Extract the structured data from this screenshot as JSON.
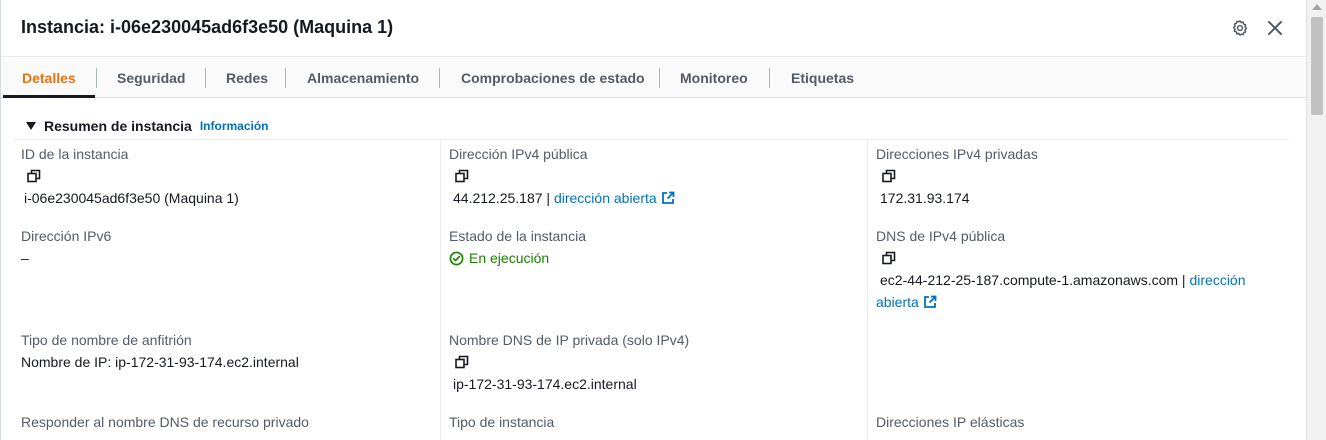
{
  "header": {
    "title": "Instancia: i-06e230045ad6f3e50 (Maquina 1)"
  },
  "tabs": [
    {
      "label": "Detalles"
    },
    {
      "label": "Seguridad"
    },
    {
      "label": "Redes"
    },
    {
      "label": "Almacenamiento"
    },
    {
      "label": "Comprobaciones de estado"
    },
    {
      "label": "Monitoreo"
    },
    {
      "label": "Etiquetas"
    }
  ],
  "section": {
    "title": "Resumen de instancia",
    "info_link": "Información"
  },
  "fields": {
    "instance_id": {
      "label": "ID de la instancia",
      "value": "i-06e230045ad6f3e50 (Maquina 1)"
    },
    "public_ipv4": {
      "label": "Dirección IPv4 pública",
      "value": "44.212.25.187 |",
      "link": "dirección abierta"
    },
    "private_ipv4": {
      "label": "Direcciones IPv4 privadas",
      "value": "172.31.93.174"
    },
    "ipv6": {
      "label": "Dirección IPv6",
      "value": "–"
    },
    "state": {
      "label": "Estado de la instancia",
      "value": "En ejecución"
    },
    "public_dns": {
      "label": "DNS de IPv4 pública",
      "value": "ec2-44-212-25-187.compute-1.amazonaws.com |",
      "link_part1": "dirección",
      "link_part2": "abierta"
    },
    "hostname_type": {
      "label": "Tipo de nombre de anfitrión",
      "value": "Nombre de IP: ip-172-31-93-174.ec2.internal"
    },
    "private_dns": {
      "label": "Nombre DNS de IP privada (solo IPv4)",
      "value": "ip-172-31-93-174.ec2.internal"
    },
    "resource_dns": {
      "label": "Responder al nombre DNS de recurso privado"
    },
    "instance_type": {
      "label": "Tipo de instancia"
    },
    "elastic_ips": {
      "label": "Direcciones IP elásticas"
    }
  },
  "icons": {
    "settings": "gear-icon",
    "close": "close-icon",
    "copy": "copy-icon",
    "external": "external-link-icon",
    "status": "check-circle-icon"
  },
  "colors": {
    "active_tab": "#ec7211",
    "link": "#0073bb",
    "success": "#1d8102",
    "text": "#16191f",
    "label": "#545b64"
  }
}
